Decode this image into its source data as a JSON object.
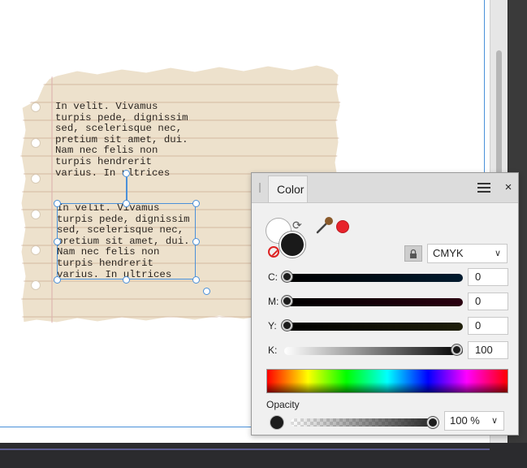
{
  "document": {
    "text_block_1": "In velit. Vivamus\nturpis pede, dignissim\nsed, scelerisque nec,\npretium sit amet, dui.\nNam nec felis non\nturpis hendrerit\nvarius. In ultrices",
    "text_block_2": "In velit. Vivamus\nturpis pede, dignissim\nsed, scelerisque nec,\npretium sit amet, dui.\nNam nec felis non\nturpis hendrerit\nvarius. In ultrices",
    "paper_color": "#ede1cc"
  },
  "color_panel": {
    "tab_label": "Color",
    "menu_icon": "hamburger-menu-icon",
    "close_label": "×",
    "picked_color": "#e8232b",
    "fill_color": "#ffffff",
    "stroke_color": "#1a1a1a",
    "color_model": "CMYK",
    "sliders": [
      {
        "label": "C:",
        "value": "0",
        "fraction": 0.0
      },
      {
        "label": "M:",
        "value": "0",
        "fraction": 0.0
      },
      {
        "label": "Y:",
        "value": "0",
        "fraction": 0.0
      },
      {
        "label": "K:",
        "value": "100",
        "fraction": 1.0
      }
    ],
    "opacity_label": "Opacity",
    "opacity_value": "100 %"
  }
}
